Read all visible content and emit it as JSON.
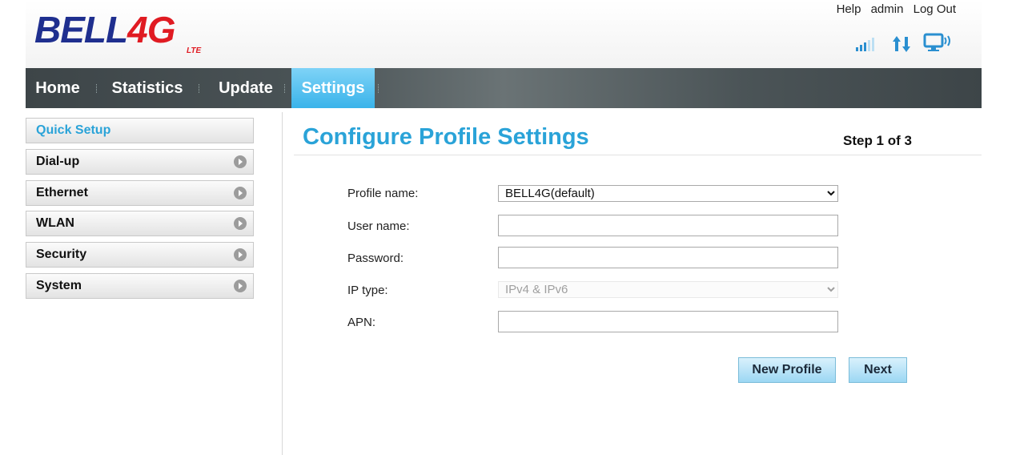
{
  "brand": {
    "word": "BELL",
    "accent": "4G",
    "sub": "LTE",
    "primary_color": "#1f2f8f",
    "accent_color": "#e01b22"
  },
  "toplinks": {
    "help": "Help",
    "user": "admin",
    "logout": "Log Out"
  },
  "status_icons": [
    "signal-strength-icon",
    "data-transfer-icon",
    "connected-device-icon"
  ],
  "nav": {
    "items": [
      {
        "label": "Home"
      },
      {
        "label": "Statistics"
      },
      {
        "label": "Update"
      },
      {
        "label": "Settings",
        "active": true
      }
    ],
    "active_color": "#39b3ea"
  },
  "sidebar": {
    "items": [
      {
        "label": "Quick Setup",
        "active": true
      },
      {
        "label": "Dial-up"
      },
      {
        "label": "Ethernet"
      },
      {
        "label": "WLAN"
      },
      {
        "label": "Security"
      },
      {
        "label": "System"
      }
    ]
  },
  "main": {
    "title": "Configure Profile Settings",
    "step": "Step 1 of 3",
    "title_color": "#2aa3d8",
    "form": {
      "profile_name_label": "Profile name:",
      "profile_name_value": "BELL4G(default)",
      "user_name_label": "User name:",
      "user_name_value": "",
      "password_label": "Password:",
      "password_value": "",
      "ip_type_label": "IP type:",
      "ip_type_value": "IPv4 & IPv6",
      "apn_label": "APN:",
      "apn_value": ""
    },
    "buttons": {
      "new_profile": "New Profile",
      "next": "Next"
    }
  }
}
